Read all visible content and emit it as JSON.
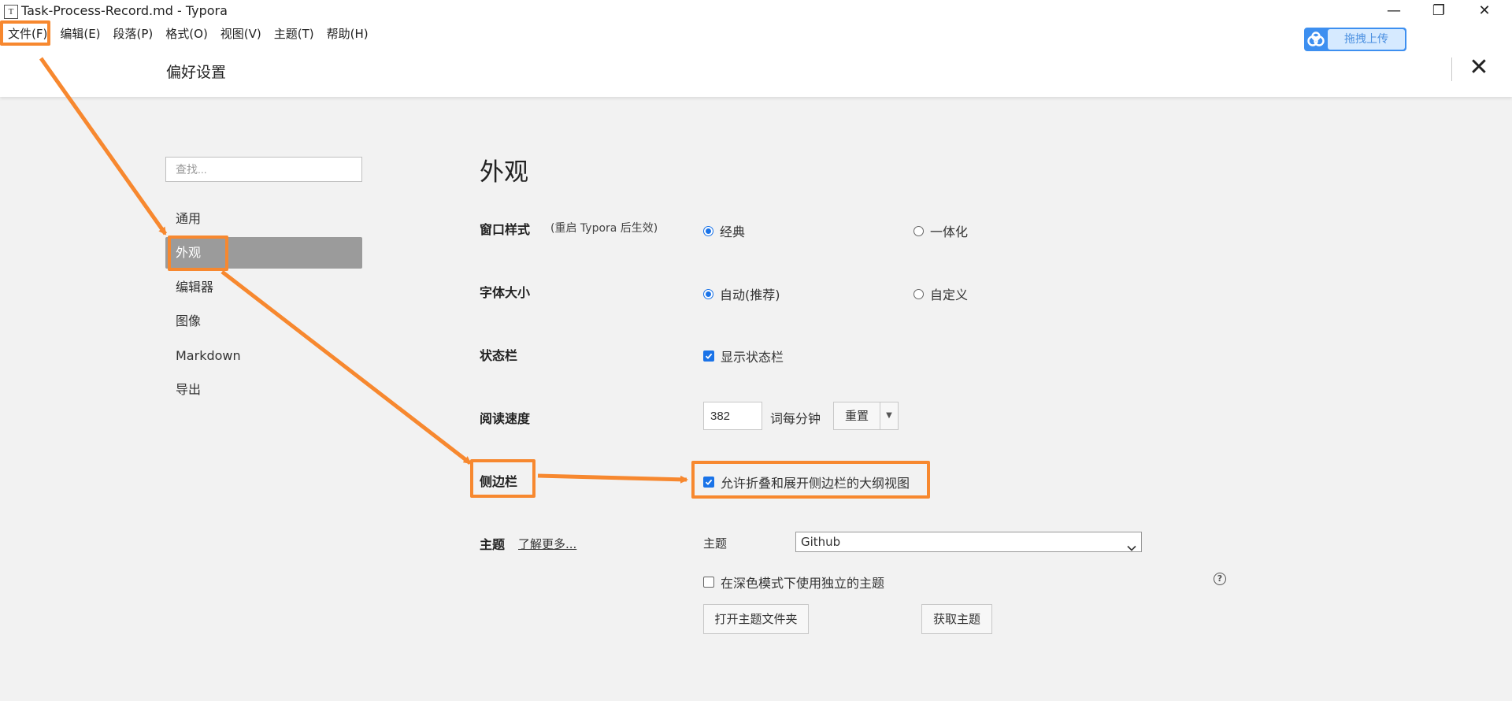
{
  "window": {
    "title": "Task-Process-Record.md - Typora",
    "app_icon_letter": "T",
    "minimize": "—",
    "restore": "❐",
    "close": "✕"
  },
  "menu": [
    {
      "label": "文件(F)"
    },
    {
      "label": "编辑(E)"
    },
    {
      "label": "段落(P)"
    },
    {
      "label": "格式(O)"
    },
    {
      "label": "视图(V)"
    },
    {
      "label": "主题(T)"
    },
    {
      "label": "帮助(H)"
    }
  ],
  "upload": {
    "label": "拖拽上传",
    "icon": "baidu-netdisk-cloud-icon"
  },
  "prefs": {
    "title": "偏好设置",
    "close": "✕"
  },
  "sidebar": {
    "search_placeholder": "查找...",
    "items": [
      {
        "label": "通用"
      },
      {
        "label": "外观",
        "active": true
      },
      {
        "label": "编辑器"
      },
      {
        "label": "图像"
      },
      {
        "label": "Markdown"
      },
      {
        "label": "导出"
      }
    ]
  },
  "appearance": {
    "title": "外观",
    "window_style": {
      "label": "窗口样式",
      "note": "(重启 Typora 后生效)",
      "options": [
        {
          "label": "经典",
          "selected": true
        },
        {
          "label": "一体化",
          "selected": false
        }
      ]
    },
    "font_size": {
      "label": "字体大小",
      "options": [
        {
          "label": "自动(推荐)",
          "selected": true
        },
        {
          "label": "自定义",
          "selected": false
        }
      ]
    },
    "status_bar": {
      "label": "状态栏",
      "checkbox": "显示状态栏",
      "checked": true
    },
    "reading_speed": {
      "label": "阅读速度",
      "value": "382",
      "unit": "词每分钟",
      "reset": "重置",
      "dropdown": "▼"
    },
    "sidebar_section": {
      "label": "侧边栏",
      "checkbox": "允许折叠和展开侧边栏的大纲视图",
      "checked": true
    },
    "theme": {
      "label": "主题",
      "learn_more": "了解更多...",
      "select_label": "主题",
      "selected": "Github",
      "dark_mode_checkbox": "在深色模式下使用独立的主题",
      "dark_mode_checked": false,
      "help": "?",
      "open_folder": "打开主题文件夹",
      "get_themes": "获取主题"
    }
  },
  "colors": {
    "accent": "#1a73e8",
    "annotation": "#f7882f",
    "sidebar_active": "#9b9b9b",
    "upload_button": "#3d8ff0"
  }
}
